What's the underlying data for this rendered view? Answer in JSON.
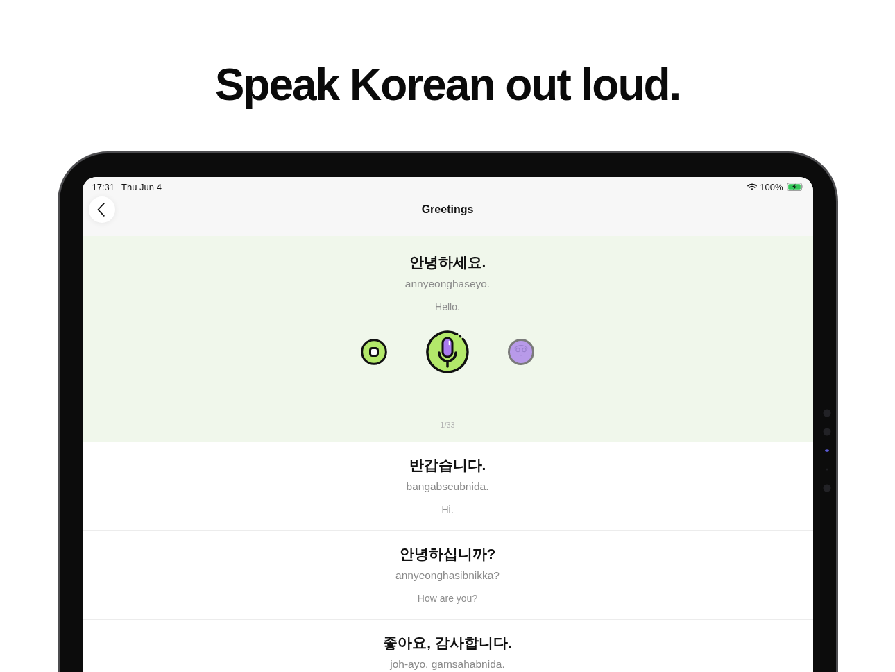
{
  "headline": "Speak Korean out loud.",
  "screen": {
    "status_bar": {
      "time": "17:31",
      "date": "Thu Jun 4",
      "battery": "100%"
    },
    "nav": {
      "title": "Greetings"
    },
    "phrases": [
      {
        "korean": "안녕하세요.",
        "romanization": "annyeonghaseyo.",
        "translation": "Hello.",
        "selected": true
      },
      {
        "korean": "반갑습니다.",
        "romanization": "bangabseubnida.",
        "translation": "Hi.",
        "selected": false
      },
      {
        "korean": "안녕하십니까?",
        "romanization": "annyeonghasibnikka?",
        "translation": "How are you?",
        "selected": false
      },
      {
        "korean": "좋아요, 감사합니다.",
        "romanization": "joh-ayo, gamsahabnida.",
        "selected": false
      }
    ],
    "player": {
      "counter": "1/33"
    }
  }
}
